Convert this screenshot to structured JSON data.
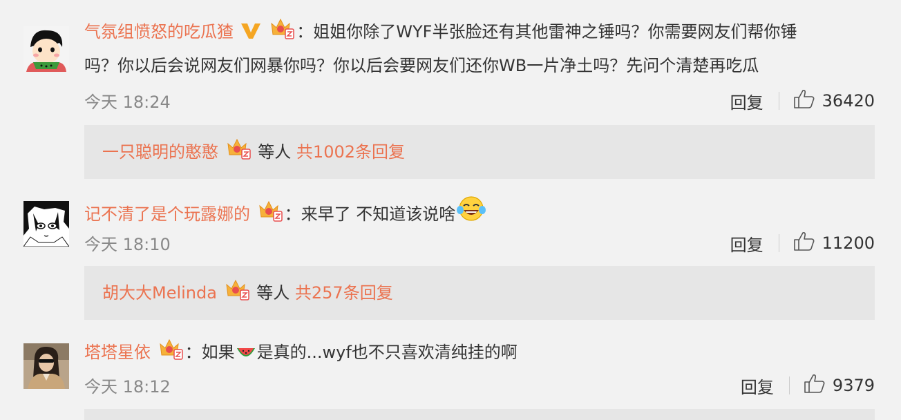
{
  "comments": [
    {
      "username": "气氛组愤怒的吃瓜猹",
      "verified_badge": "V",
      "text_line1": "：姐姐你除了WYF半张脸还有其他雷神之锤吗？你需要网友们帮你锤",
      "text_line2": "吗？你以后会说网友们网暴你吗？你以后会要网友们还你WB一片净土吗？先问个清楚再吃瓜",
      "time": "今天 18:24",
      "reply_label": "回复",
      "likes": "36420",
      "replies": {
        "first_user": "一只聪明的憨憨",
        "suffix": "等人",
        "total": "共1002条回复"
      }
    },
    {
      "username": "记不清了是个玩露娜的",
      "text_line1": "：来早了 不知道该说啥",
      "time": "今天 18:10",
      "reply_label": "回复",
      "likes": "11200",
      "replies": {
        "first_user": "胡大大Melinda",
        "suffix": "等人",
        "total": "共257条回复"
      }
    },
    {
      "username": "塔塔星依",
      "text_before_emoji": "：如果",
      "text_after_emoji": "是真的...wyf也不只喜欢清纯挂的啊",
      "time": "今天 18:12",
      "reply_label": "回复",
      "likes": "9379"
    }
  ],
  "colors": {
    "username": "#eb7350",
    "background": "#f2f2f2",
    "reply_box": "#e6e6e6"
  }
}
